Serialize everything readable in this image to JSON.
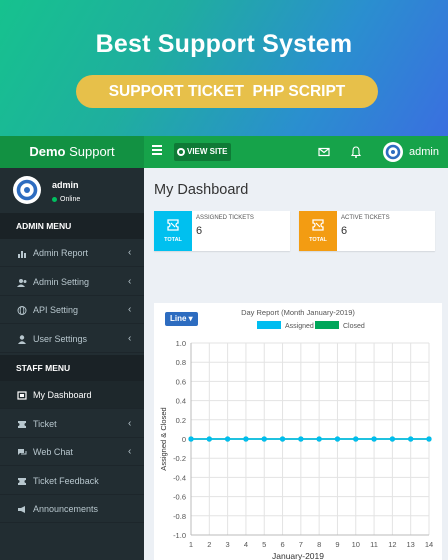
{
  "banner": {
    "title": "Best Support System",
    "subtitle": "SUPPORT TICKET  PHP SCRIPT"
  },
  "topbar": {
    "brand_bold": "Demo",
    "brand_rest": " Support",
    "view_site": "VIEW SITE",
    "user": "admin"
  },
  "sidebar": {
    "user": {
      "name": "admin",
      "status": "Online"
    },
    "admin_header": "ADMIN MENU",
    "admin_items": [
      {
        "label": "Admin Report",
        "icon": "bar-chart-icon",
        "has_chevron": true
      },
      {
        "label": "Admin Setting",
        "icon": "users-icon",
        "has_chevron": true
      },
      {
        "label": "API Setting",
        "icon": "globe-icon",
        "has_chevron": true
      },
      {
        "label": "User Settings",
        "icon": "user-icon",
        "has_chevron": true
      }
    ],
    "staff_header": "STAFF MENU",
    "staff_items": [
      {
        "label": "My Dashboard",
        "icon": "dashboard-icon",
        "has_chevron": false,
        "active": true
      },
      {
        "label": "Ticket",
        "icon": "ticket-icon",
        "has_chevron": true
      },
      {
        "label": "Web Chat",
        "icon": "chat-icon",
        "has_chevron": true
      },
      {
        "label": "Ticket Feedback",
        "icon": "ticket-icon",
        "has_chevron": false
      },
      {
        "label": "Announcements",
        "icon": "bullhorn-icon",
        "has_chevron": false
      }
    ]
  },
  "main": {
    "title": "My Dashboard",
    "boxes": [
      {
        "label": "ASSIGNED TICKETS",
        "total": "TOTAL",
        "value": "6",
        "color": "#00c0ef"
      },
      {
        "label": "ACTIVE TICKETS",
        "total": "TOTAL",
        "value": "6",
        "color": "#f39c12"
      }
    ],
    "chart_type_select": "Line ▾"
  },
  "chart_data": {
    "type": "line",
    "title": "Day Report (Month January-2019)",
    "xlabel": "January-2019",
    "ylabel": "Assigned & Closed",
    "x": [
      1,
      2,
      3,
      4,
      5,
      6,
      7,
      8,
      9,
      10,
      11,
      12,
      13,
      14
    ],
    "xlim": [
      1,
      14
    ],
    "ylim": [
      -1.0,
      1.0
    ],
    "yticks": [
      "1.0",
      "0.8",
      "0.6",
      "0.4",
      "0.2",
      "0",
      "-0.2",
      "-0.4",
      "-0.6",
      "-0.8",
      "-1.0"
    ],
    "ytick_values": [
      1.0,
      0.8,
      0.6,
      0.4,
      0.2,
      0,
      -0.2,
      -0.4,
      -0.6,
      -0.8,
      -1.0
    ],
    "grid": true,
    "legend_position": "top",
    "series": [
      {
        "name": "Assigned",
        "color": "#00bdf0",
        "values": [
          0,
          0,
          0,
          0,
          0,
          0,
          0,
          0,
          0,
          0,
          0,
          0,
          0,
          0
        ]
      },
      {
        "name": "Closed",
        "color": "#00a65a",
        "values": [
          0,
          0,
          0,
          0,
          0,
          0,
          0,
          0,
          0,
          0,
          0,
          0,
          0,
          0
        ]
      }
    ]
  }
}
